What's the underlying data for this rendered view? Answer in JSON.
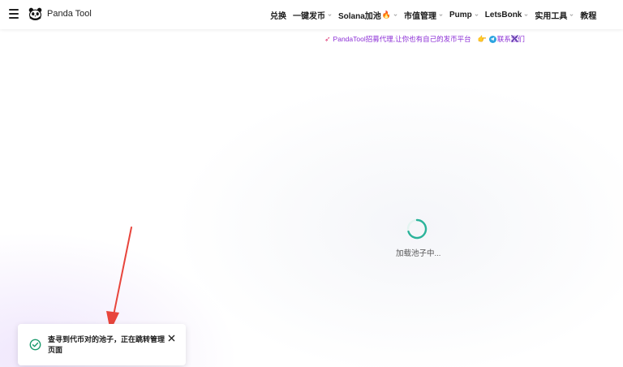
{
  "header": {
    "brand": "Panda Tool",
    "nav": [
      {
        "label": "兑换",
        "dropdown": false,
        "icon": null
      },
      {
        "label": "一键发币",
        "dropdown": true,
        "icon": null
      },
      {
        "label": "Solana加池",
        "dropdown": true,
        "icon": "fire-icon"
      },
      {
        "label": "市值管理",
        "dropdown": true,
        "icon": null
      },
      {
        "label": "Pump",
        "dropdown": true,
        "icon": null
      },
      {
        "label": "LetsBonk",
        "dropdown": true,
        "icon": null
      },
      {
        "label": "实用工具",
        "dropdown": true,
        "icon": null
      },
      {
        "label": "教程",
        "dropdown": false,
        "icon": null
      }
    ]
  },
  "banner": {
    "text": "PandaTool招募代理,让你也有自己的发币平台",
    "contact": "联系我们",
    "color": "#8c2fd6"
  },
  "loading": {
    "text": "加载池子中...",
    "spinner_color": "#2bb39a"
  },
  "toast": {
    "message": "查寻到代币对的池子，正在跳转管理页面",
    "status": "success",
    "status_color": "#1b9a6c"
  },
  "annotation": {
    "arrow_color": "#e8453c"
  }
}
